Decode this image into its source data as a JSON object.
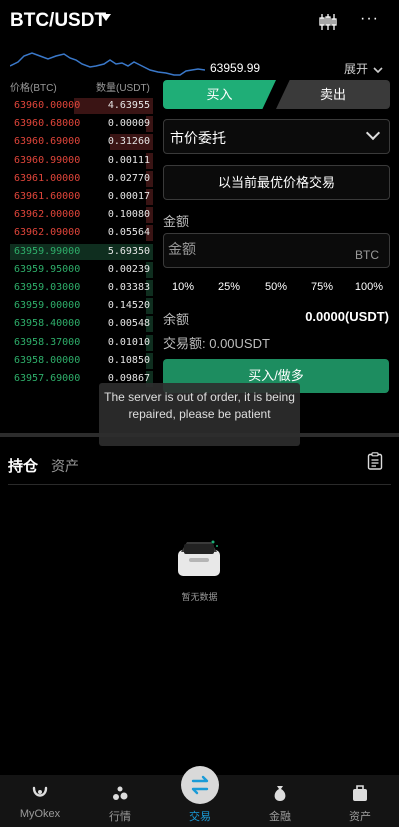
{
  "header": {
    "pair": "BTC/USDT",
    "more": "···"
  },
  "price_strip": {
    "last_price": "63959.99",
    "expand_label": "展开"
  },
  "orderbook": {
    "col_price": "价格(BTC)",
    "col_qty": "数量(USDT)",
    "asks": [
      {
        "price": "63960.00000",
        "qty": "4.63955",
        "depth": 0.55
      },
      {
        "price": "63960.68000",
        "qty": "0.00009",
        "depth": 0.05
      },
      {
        "price": "63960.69000",
        "qty": "0.31260",
        "depth": 0.3
      },
      {
        "price": "63960.99000",
        "qty": "0.00111",
        "depth": 0.05
      },
      {
        "price": "63961.00000",
        "qty": "0.02770",
        "depth": 0.05
      },
      {
        "price": "63961.60000",
        "qty": "0.00017",
        "depth": 0.05
      },
      {
        "price": "63962.00000",
        "qty": "0.10080",
        "depth": 0.05
      },
      {
        "price": "63962.09000",
        "qty": "0.05564",
        "depth": 0.05
      }
    ],
    "bids": [
      {
        "price": "63959.99000",
        "qty": "5.69350",
        "depth": 1.0
      },
      {
        "price": "63959.95000",
        "qty": "0.00239",
        "depth": 0.05
      },
      {
        "price": "63959.03000",
        "qty": "0.03383",
        "depth": 0.05
      },
      {
        "price": "63959.00000",
        "qty": "0.14520",
        "depth": 0.05
      },
      {
        "price": "63958.40000",
        "qty": "0.00548",
        "depth": 0.05
      },
      {
        "price": "63958.37000",
        "qty": "0.01010",
        "depth": 0.05
      },
      {
        "price": "63958.00000",
        "qty": "0.10850",
        "depth": 0.05
      },
      {
        "price": "63957.69000",
        "qty": "0.09867",
        "depth": 0.05
      }
    ]
  },
  "trade": {
    "tab_buy": "买入",
    "tab_sell": "卖出",
    "order_type": "市价委托",
    "best_price_button": "以当前最优价格交易",
    "amount_label": "金额",
    "amount_placeholder": "金额",
    "amount_unit": "BTC",
    "percents": [
      "10%",
      "25%",
      "50%",
      "75%",
      "100%"
    ],
    "balance_label": "余额",
    "balance_value": "0.0000(USDT)",
    "volume_label": "交易额: 0.00USDT",
    "submit": "买入/做多"
  },
  "toast": {
    "message": "The server is out of order, it is being repaired, please be patient"
  },
  "positions": {
    "tab_positions": "持仓",
    "tab_assets": "资产",
    "empty_text": "暂无数据"
  },
  "nav": {
    "items": [
      {
        "label": "MyOkex",
        "icon": "myokex-icon"
      },
      {
        "label": "行情",
        "icon": "market-icon"
      },
      {
        "label": "交易",
        "icon": "trade-icon"
      },
      {
        "label": "金融",
        "icon": "finance-icon"
      },
      {
        "label": "资产",
        "icon": "assets-icon"
      }
    ]
  },
  "colors": {
    "buy": "#1fae77",
    "ask_text": "#e0453a",
    "bid_text": "#2eae6a",
    "line": "#3a78c9"
  }
}
